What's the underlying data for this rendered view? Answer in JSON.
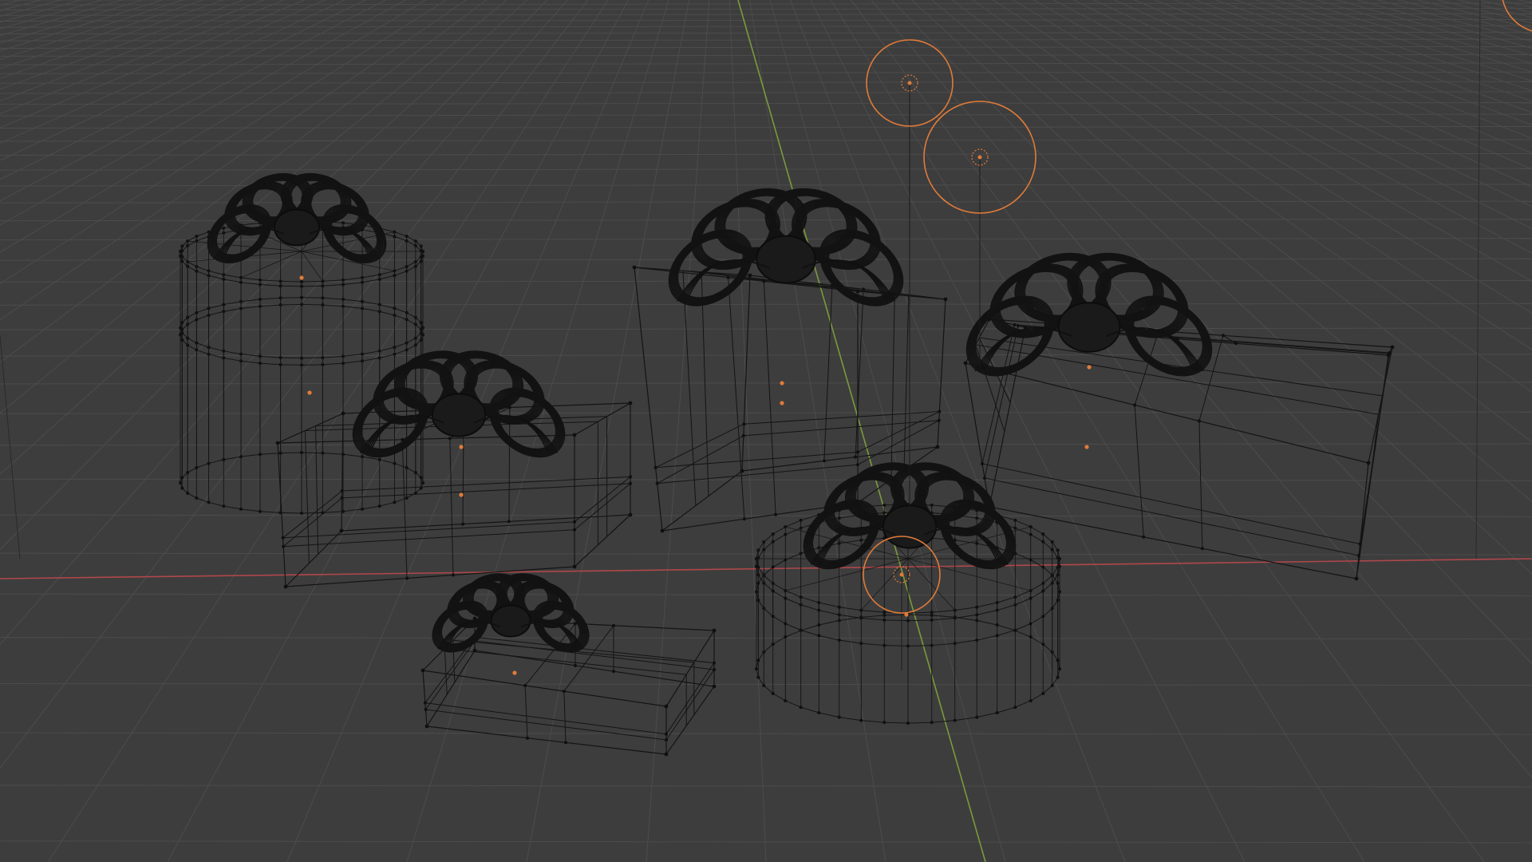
{
  "app": {
    "editor": "3D Viewport",
    "shading_mode": "wireframe"
  },
  "colors": {
    "background": "#3d3d3d",
    "grid_line": "#4c4c4c",
    "grid_line_major": "#4a4a4a",
    "x_axis": "#b0474a",
    "y_axis": "#7a9a3c",
    "wire": "#141414",
    "vertex": "#101010",
    "origin": "#e07b39",
    "light": "#e07b39",
    "light_line": "#1b1b1b"
  },
  "scene": {
    "objects": [
      {
        "name": "gift-cylinder-tall",
        "type": "cylinder-gift",
        "selected": false
      },
      {
        "name": "gift-box-medium",
        "type": "box-gift",
        "selected": false
      },
      {
        "name": "gift-box-tall",
        "type": "box-gift",
        "selected": false
      },
      {
        "name": "gift-box-long",
        "type": "box-gift",
        "selected": false
      },
      {
        "name": "gift-box-small",
        "type": "box-gift",
        "selected": false
      },
      {
        "name": "gift-cylinder-short",
        "type": "cylinder-gift",
        "selected": false
      },
      {
        "name": "point-light-1",
        "type": "light",
        "selected": false
      },
      {
        "name": "point-light-2",
        "type": "light",
        "selected": false
      },
      {
        "name": "point-light-3",
        "type": "light",
        "selected": false
      }
    ]
  }
}
